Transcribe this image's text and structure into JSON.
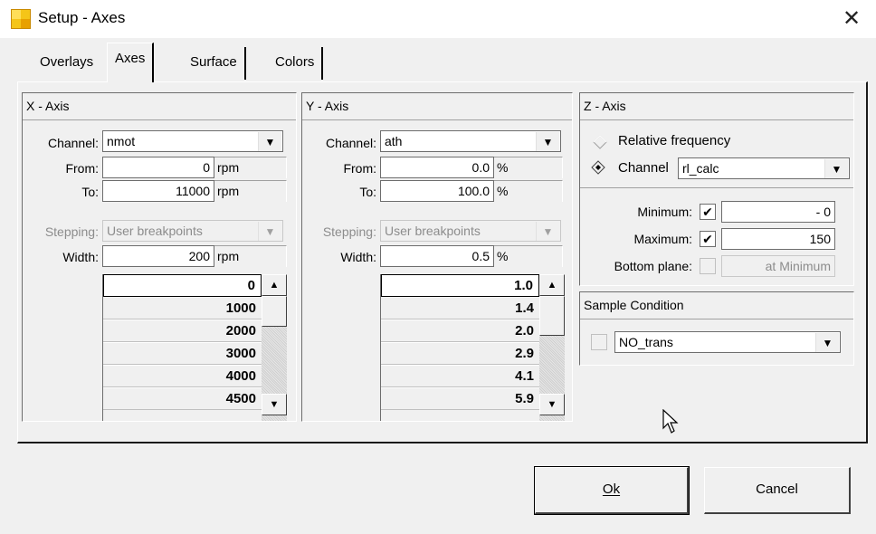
{
  "window": {
    "title": "Setup - Axes"
  },
  "tabs": [
    {
      "label": "Overlays"
    },
    {
      "label": "Axes"
    },
    {
      "label": "Surface"
    },
    {
      "label": "Colors"
    }
  ],
  "x_axis": {
    "header": "X - Axis",
    "channel_label": "Channel:",
    "channel_value": "nmot",
    "from_label": "From:",
    "from_value": "0",
    "from_unit": "rpm",
    "to_label": "To:",
    "to_value": "11000",
    "to_unit": "rpm",
    "stepping_label": "Stepping:",
    "stepping_value": "User breakpoints",
    "width_label": "Width:",
    "width_value": "200",
    "width_unit": "rpm",
    "breakpoints": [
      "0",
      "1000",
      "2000",
      "3000",
      "4000",
      "4500"
    ]
  },
  "y_axis": {
    "header": "Y - Axis",
    "channel_label": "Channel:",
    "channel_value": "ath",
    "from_label": "From:",
    "from_value": "0.0",
    "from_unit": "%",
    "to_label": "To:",
    "to_value": "100.0",
    "to_unit": "%",
    "stepping_label": "Stepping:",
    "stepping_value": "User breakpoints",
    "width_label": "Width:",
    "width_value": "0.5",
    "width_unit": "%",
    "breakpoints": [
      "1.0",
      "1.4",
      "2.0",
      "2.9",
      "4.1",
      "5.9"
    ]
  },
  "z_axis": {
    "header": "Z - Axis",
    "relative_frequency_label": "Relative frequency",
    "channel_label": "Channel",
    "channel_value": "rl_calc",
    "minimum_label": "Minimum:",
    "minimum_checked": true,
    "minimum_value": "- 0",
    "maximum_label": "Maximum:",
    "maximum_checked": true,
    "maximum_value": "150",
    "bottom_plane_label": "Bottom plane:",
    "bottom_plane_checked": false,
    "bottom_plane_value": "at Minimum"
  },
  "sample_condition": {
    "header": "Sample Condition",
    "value": "NO_trans"
  },
  "buttons": {
    "ok_label": "Ok",
    "cancel_label": "Cancel"
  },
  "icons": {
    "close": "close-icon",
    "dropdown": "chevron-down-icon",
    "check": "checkmark-icon",
    "cursor": "mouse-pointer-icon"
  }
}
